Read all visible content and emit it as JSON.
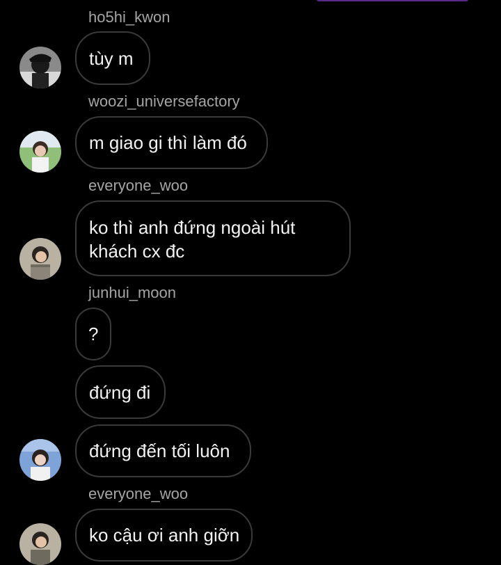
{
  "colors": {
    "background": "#000000",
    "bubble_border": "#3a3a3a",
    "username_text": "#a5a5a5",
    "message_text": "#f2f2f2",
    "accent_bar": "#5b2a86"
  },
  "messages": [
    {
      "username": "ho5hi_kwon",
      "bubbles": [
        "tùy m"
      ]
    },
    {
      "username": "woozi_universefactory",
      "bubbles": [
        "m giao gi thì làm đó"
      ]
    },
    {
      "username": "everyone_woo",
      "bubbles": [
        "ko thì anh đứng ngoài hút khách cx đc"
      ]
    },
    {
      "username": "junhui_moon",
      "bubbles": [
        "?",
        "đứng đi",
        "đứng đến tối luôn"
      ]
    },
    {
      "username": "everyone_woo",
      "bubbles": [
        "ko cậu ơi anh giỡn"
      ]
    }
  ],
  "line_breaks": {
    "m3_line1": "ko thì anh đứng ngoài hút",
    "m3_line2": "khách cx đc"
  }
}
